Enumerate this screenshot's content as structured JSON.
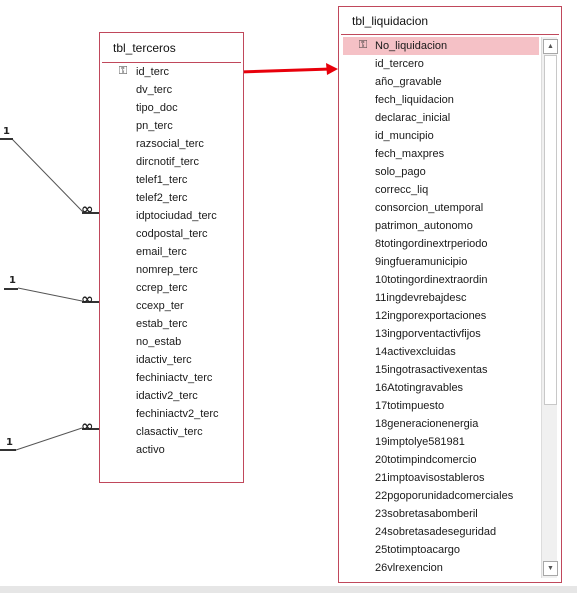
{
  "relations": {
    "one_label": "1",
    "many_label": "∞"
  },
  "tbl_terceros": {
    "title": "tbl_terceros",
    "fields": [
      {
        "name": "id_terc",
        "key": true
      },
      {
        "name": "dv_terc"
      },
      {
        "name": "tipo_doc"
      },
      {
        "name": "pn_terc"
      },
      {
        "name": "razsocial_terc"
      },
      {
        "name": "dircnotif_terc"
      },
      {
        "name": "telef1_terc"
      },
      {
        "name": "telef2_terc"
      },
      {
        "name": "idptociudad_terc"
      },
      {
        "name": "codpostal_terc"
      },
      {
        "name": "email_terc"
      },
      {
        "name": "nomrep_terc"
      },
      {
        "name": "ccrep_terc"
      },
      {
        "name": "ccexp_ter"
      },
      {
        "name": "estab_terc"
      },
      {
        "name": "no_estab"
      },
      {
        "name": "idactiv_terc"
      },
      {
        "name": "fechiniactv_terc"
      },
      {
        "name": "idactiv2_terc"
      },
      {
        "name": "fechiniactv2_terc"
      },
      {
        "name": "clasactiv_terc"
      },
      {
        "name": "activo"
      }
    ]
  },
  "tbl_liquidacion": {
    "title": "tbl_liquidacion",
    "fields": [
      {
        "name": "No_liquidacion",
        "key": true,
        "selected": true
      },
      {
        "name": "id_tercero"
      },
      {
        "name": "año_gravable"
      },
      {
        "name": "fech_liquidacion"
      },
      {
        "name": "declarac_inicial"
      },
      {
        "name": "id_muncipio"
      },
      {
        "name": "fech_maxpres"
      },
      {
        "name": "solo_pago"
      },
      {
        "name": "correcc_liq"
      },
      {
        "name": "consorcion_utemporal"
      },
      {
        "name": "patrimon_autonomo"
      },
      {
        "name": "8totingordinextrperiodo"
      },
      {
        "name": "9ingfueramunicipio"
      },
      {
        "name": "10totingordinextraordin"
      },
      {
        "name": "11ingdevrebajdesc"
      },
      {
        "name": "12ingporexportaciones"
      },
      {
        "name": "13ingporventactivfijos"
      },
      {
        "name": "14activexcluidas"
      },
      {
        "name": "15ingotrasactivexentas"
      },
      {
        "name": "16Atotingravables"
      },
      {
        "name": "17totimpuesto"
      },
      {
        "name": "18generacionenergia"
      },
      {
        "name": "19imptolye581981"
      },
      {
        "name": "20totimpindcomercio"
      },
      {
        "name": "21imptoavisostableros"
      },
      {
        "name": "22pgoporunidadcomerciales"
      },
      {
        "name": "23sobretasabomberil"
      },
      {
        "name": "24sobretasadeseguridad"
      },
      {
        "name": "25totimptoacargo"
      },
      {
        "name": "26vlrexencion"
      }
    ],
    "scroll_position": 0,
    "scroll_visible_fraction": 0.66
  },
  "icons": {
    "key": "key-icon",
    "scroll_up": "scroll-up-arrow-icon",
    "scroll_down": "scroll-down-arrow-icon",
    "annotation_arrow": "red-arrow-icon"
  },
  "colors": {
    "table_border": "#c0485b",
    "selected_row": "#f5c1c6",
    "annotation": "#e8000b",
    "relation_line": "#333333"
  }
}
